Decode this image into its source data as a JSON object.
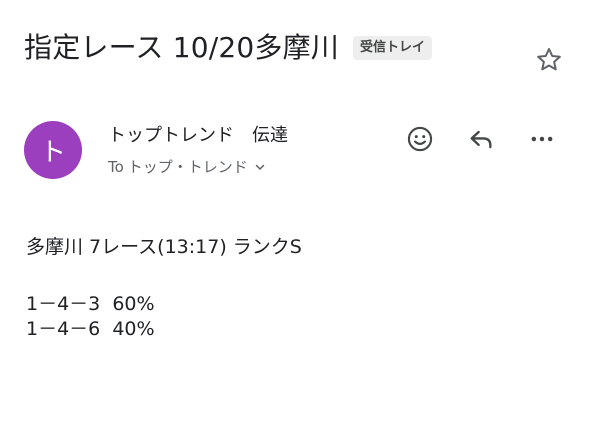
{
  "email": {
    "subject": "指定レース 10/20多摩川",
    "label": "受信トレイ",
    "sender": {
      "avatar_letter": "ト",
      "name": "トップトレンド　伝達",
      "to_prefix": "To",
      "to_name": "トップ・トレンド"
    },
    "actions": {
      "emoji": "smiley-icon",
      "reply": "reply-icon",
      "more": "more-icon"
    },
    "body": {
      "line1": "多摩川 7レース(13:17) ランクS",
      "line2": "1－4－3  60%",
      "line3": "1－4－6  40%"
    }
  },
  "colors": {
    "avatar": "#9c3fbf",
    "label_bg": "#eeeeee",
    "icon": "#444746"
  }
}
